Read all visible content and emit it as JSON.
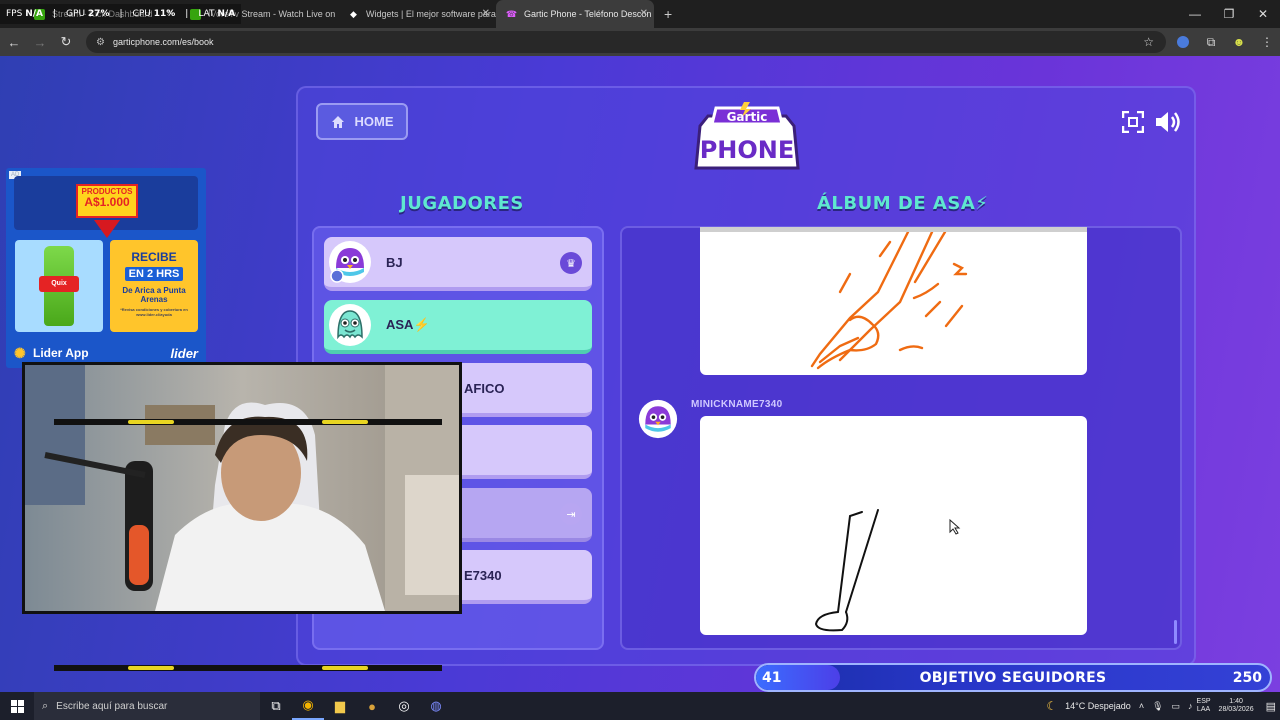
{
  "browser": {
    "tabs": [
      {
        "title": "Stream - Kick Dashboard",
        "favicon": "kick-icon",
        "color": "#53fc18"
      },
      {
        "title": "IVoreTv Stream - Watch Live on",
        "favicon": "kick-icon",
        "color": "#53fc18"
      },
      {
        "title": "Widgets | El mejor software para",
        "favicon": "diamond-icon",
        "color": "#ffffff"
      },
      {
        "title": "Gartic Phone - Teléfono Descon",
        "favicon": "phone-icon",
        "color": "#d34cff",
        "active": true
      }
    ],
    "new_tab": "+",
    "url": "garticphone.com/es/book"
  },
  "stats_overlay": {
    "fps_label": "FPS",
    "fps_value": "N/A",
    "gpu_label": "GPU",
    "gpu_value": "27",
    "cpu_label": "CPU",
    "cpu_value": "11",
    "lat_label": "LAT",
    "lat_value": "N/A"
  },
  "game": {
    "home_label": "HOME",
    "logo_top": "Gartic",
    "logo_bottom": "PHONE",
    "players_heading": "JUGADORES",
    "album_heading": "ÁLBUM DE ASA⚡",
    "players": [
      {
        "name": "BJ",
        "badge": "crown",
        "highlighted": false
      },
      {
        "name": "ASA⚡",
        "badge": "",
        "highlighted": true
      },
      {
        "name": "AFICO",
        "badge": "",
        "highlighted": false
      },
      {
        "name": "",
        "badge": "",
        "highlighted": false
      },
      {
        "name": "",
        "badge": "exit",
        "highlighted": false
      },
      {
        "name": "E7340",
        "badge": "",
        "highlighted": false
      }
    ],
    "message_author": "MINICKNAME7340"
  },
  "ad": {
    "tag": "AD",
    "promo_line1": "PRODUCTOS",
    "promo_line2": "A$1.000",
    "offer_line1": "RECIBE",
    "offer_line2": "EN 2 HRS",
    "offer_line3": "De Arica a Punta Arenas",
    "offer_fine": "*Revisa condiciones y cobertura en www.lider.cl/ayuda",
    "bottle_label": "Quix",
    "footer_app": "Lider App",
    "footer_brand": "lider"
  },
  "goal": {
    "current": "41",
    "label": "OBJETIVO SEGUIDORES",
    "target": "250",
    "progress": 0.164
  },
  "taskbar": {
    "search_placeholder": "Escribe aquí para buscar",
    "weather": "14°C  Despejado",
    "lang_top": "ESP",
    "lang_bottom": "LAA",
    "time": "1:40",
    "date": "28/03/2026"
  }
}
